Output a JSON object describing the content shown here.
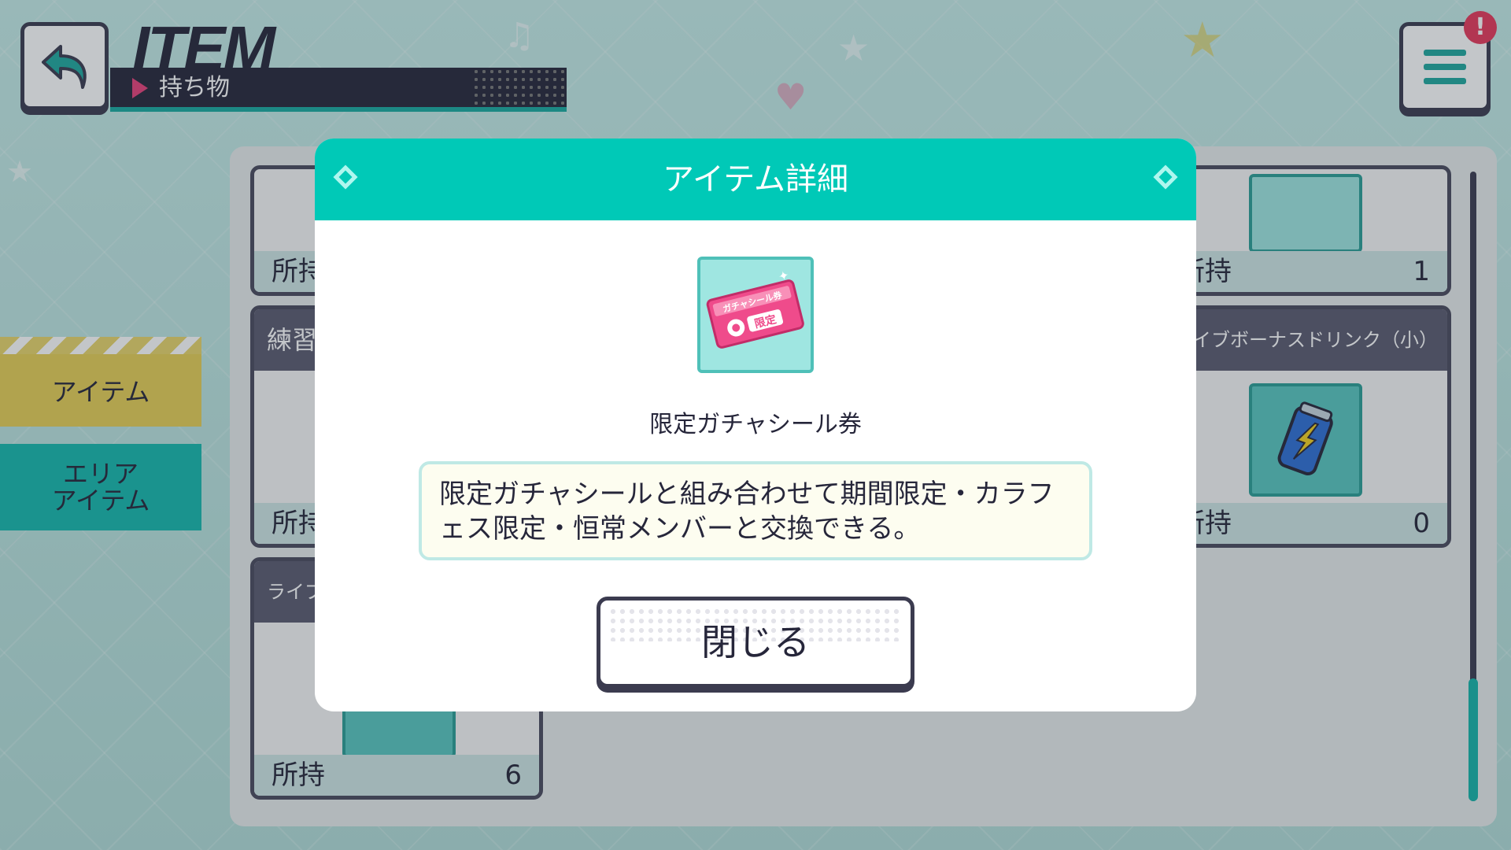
{
  "header": {
    "title": "ITEM",
    "subtitle": "持ち物",
    "notification_badge": "!"
  },
  "sidebar": {
    "tabs": [
      {
        "label": "アイテム",
        "active": true
      },
      {
        "label": "エリア\nアイテム",
        "active": false
      }
    ]
  },
  "inventory": {
    "cards": [
      {
        "header": "",
        "owned_label": "所持",
        "count": ""
      },
      {
        "header": "",
        "owned_label": "所持",
        "count": "1"
      },
      {
        "header": "練習",
        "owned_label": "所持",
        "count": ""
      },
      {
        "header": "イブボーナスドリンク（小）",
        "owned_label": "所持",
        "count": "0"
      },
      {
        "header": "ライブ",
        "owned_label": "所持",
        "count": "6"
      }
    ]
  },
  "modal": {
    "title": "アイテム詳細",
    "item_name": "限定ガチャシール券",
    "item_icon_text_top": "ガチャシール券",
    "item_icon_text_badge": "限定",
    "description": "限定ガチャシールと組み合わせて期間限定・カラフェス限定・恒常メンバーと交換できる。",
    "close_label": "閉じる"
  },
  "colors": {
    "accent": "#00c9b7",
    "tab_active": "#e6cf55",
    "tab_inactive": "#16b9ad",
    "dark": "#26263a",
    "ticket_pink": "#e8407a"
  }
}
